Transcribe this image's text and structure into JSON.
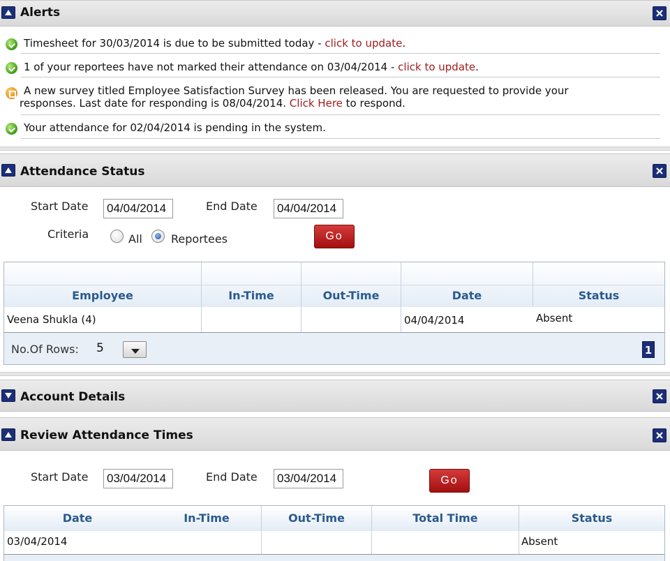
{
  "alerts": {
    "title": "Alerts",
    "items": [
      {
        "text": "Timesheet for 30/03/2014 is due to be submitted today - ",
        "link": "click to update",
        "tail": ".",
        "icon": "green"
      },
      {
        "text": "1 of your reportees have not marked their attendance on 03/04/2014 - ",
        "link": "click to update",
        "tail": ".",
        "icon": "green"
      },
      {
        "text": "A new survey titled Employee Satisfaction Survey has been released. You are requested to provide your",
        "text2": "responses. Last date for responding is 08/04/2014. ",
        "link": "Click Here",
        "tail": " to respond.",
        "icon": "orange"
      },
      {
        "text": "Your attendance for 02/04/2014 is pending in the system.",
        "icon": "green"
      }
    ]
  },
  "attendance": {
    "title": "Attendance Status",
    "start_label": "Start Date",
    "start_value": "04/04/2014",
    "end_label": "End Date",
    "end_value": "04/04/2014",
    "criteria_label": "Criteria",
    "options": [
      "All",
      "Reportees"
    ],
    "selected": "Reportees",
    "go_label": "Go",
    "columns": [
      "Employee",
      "In-Time",
      "Out-Time",
      "Date",
      "Status"
    ],
    "rows": [
      [
        "Veena Shukla (4)",
        "",
        "",
        "04/04/2014",
        "Absent"
      ]
    ],
    "rows_label": "No.Of Rows:",
    "rows_value": "5",
    "page": "1"
  },
  "account": {
    "title": "Account Details"
  },
  "review": {
    "title": "Review Attendance Times",
    "start_label": "Start Date",
    "start_value": "03/04/2014",
    "end_label": "End Date",
    "end_value": "03/04/2014",
    "go_label": "Go",
    "columns": [
      "Date",
      "In-Time",
      "Out-Time",
      "Total Time",
      "Status"
    ],
    "rows": [
      [
        "03/04/2014",
        "",
        "",
        "",
        "Absent"
      ]
    ]
  },
  "colors": {
    "panel_icon": "#1b2e78",
    "link": "#9e1b1b",
    "grid_header_text": "#2a5a8e",
    "go_button": "#b81f1f"
  },
  "icons": {
    "collapse": "triangle-up-icon",
    "expand": "triangle-down-icon",
    "close": "close-x-icon",
    "alert_ok": "green-check-icon",
    "alert_info": "orange-lock-icon"
  }
}
